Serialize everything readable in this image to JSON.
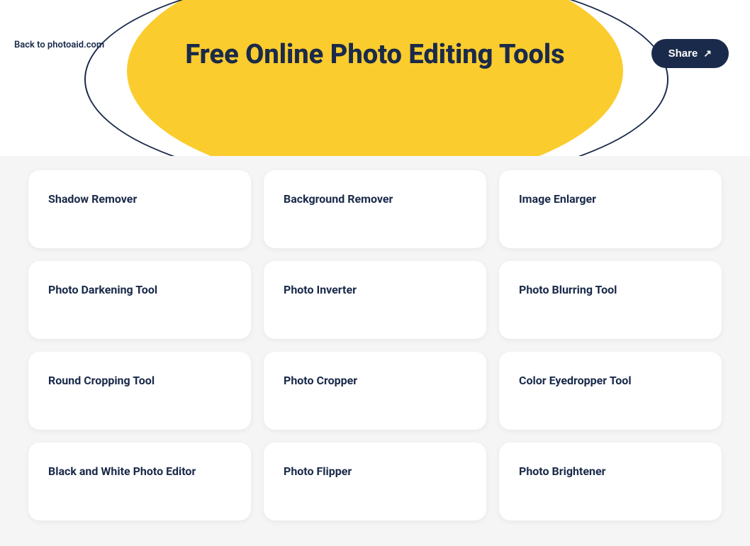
{
  "header": {
    "back_label": "Back to\nphotoaid.com",
    "title": "Free Online Photo Editing Tools",
    "share_label": "Share"
  },
  "tools": [
    {
      "label": "Shadow Remover"
    },
    {
      "label": "Background Remover"
    },
    {
      "label": "Image Enlarger"
    },
    {
      "label": "Photo Darkening Tool"
    },
    {
      "label": "Photo Inverter"
    },
    {
      "label": "Photo Blurring Tool"
    },
    {
      "label": "Round Cropping Tool"
    },
    {
      "label": "Photo Cropper"
    },
    {
      "label": "Color Eyedropper Tool"
    },
    {
      "label": "Black and White Photo Editor"
    },
    {
      "label": "Photo Flipper"
    },
    {
      "label": "Photo Brightener"
    }
  ]
}
